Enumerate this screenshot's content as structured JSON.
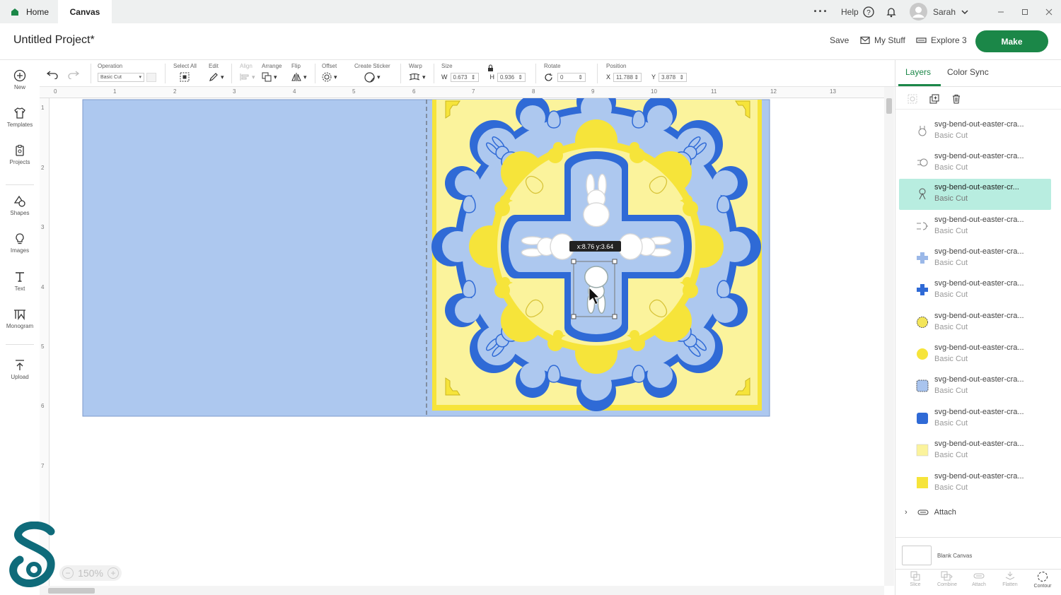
{
  "titlebar": {
    "tabs": [
      {
        "label": "Home"
      },
      {
        "label": "Canvas"
      }
    ],
    "help_label": "Help",
    "user_name": "Sarah"
  },
  "header": {
    "project_title": "Untitled Project*",
    "save_label": "Save",
    "my_stuff_label": "My Stuff",
    "explore_label": "Explore 3",
    "make_label": "Make"
  },
  "toolbar": {
    "operation_label": "Operation",
    "operation_value": "Basic Cut",
    "select_all_label": "Select All",
    "edit_label": "Edit",
    "align_label": "Align",
    "arrange_label": "Arrange",
    "flip_label": "Flip",
    "offset_label": "Offset",
    "create_sticker_label": "Create Sticker",
    "warp_label": "Warp",
    "size_label": "Size",
    "size_w_label": "W",
    "size_w": "0.673",
    "size_h_label": "H",
    "size_h": "0.936",
    "rotate_label": "Rotate",
    "rotate_value": "0",
    "position_label": "Position",
    "pos_x_label": "X",
    "pos_x": "11.788",
    "pos_y_label": "Y",
    "pos_y": "3.878"
  },
  "left_tools": [
    {
      "label": "New"
    },
    {
      "label": "Templates"
    },
    {
      "label": "Projects"
    },
    {
      "label": "Shapes"
    },
    {
      "label": "Images"
    },
    {
      "label": "Text"
    },
    {
      "label": "Monogram"
    },
    {
      "label": "Upload"
    }
  ],
  "rulers": {
    "top": [
      "0",
      "1",
      "2",
      "3",
      "4",
      "5",
      "6",
      "7",
      "8",
      "9",
      "10",
      "11",
      "12",
      "13"
    ],
    "left": [
      "1",
      "2",
      "3",
      "4",
      "5",
      "6",
      "7"
    ]
  },
  "canvas": {
    "tooltip": "x:8.76 y:3.64",
    "zoom": "150%",
    "colors": {
      "light_blue": "#adc8ef",
      "dark_blue": "#2f6ad6",
      "yellow": "#f6e43a",
      "light_yellow": "#fbf39c"
    }
  },
  "right_panel": {
    "tabs": [
      {
        "label": "Layers"
      },
      {
        "label": "Color Sync"
      }
    ],
    "layers": [
      {
        "name": "svg-bend-out-easter-cra...",
        "op": "Basic Cut",
        "swatch": "#ffffff",
        "icon": "bunny-outline-icon"
      },
      {
        "name": "svg-bend-out-easter-cra...",
        "op": "Basic Cut",
        "swatch": "#ffffff",
        "icon": "bunny-outline-icon"
      },
      {
        "name": "svg-bend-out-easter-cr...",
        "op": "Basic Cut",
        "swatch": "#ffffff",
        "icon": "bunny-outline-icon"
      },
      {
        "name": "svg-bend-out-easter-cra...",
        "op": "Basic Cut",
        "swatch": "#ffffff",
        "icon": "bunny-outline-icon"
      },
      {
        "name": "svg-bend-out-easter-cra...",
        "op": "Basic Cut",
        "swatch": "#9bb8e8",
        "icon": "cross-shape-icon"
      },
      {
        "name": "svg-bend-out-easter-cra...",
        "op": "Basic Cut",
        "swatch": "#2f6ad6",
        "icon": "cross-shape-icon"
      },
      {
        "name": "svg-bend-out-easter-cra...",
        "op": "Basic Cut",
        "swatch": "#f3e55a",
        "icon": "flower-shape-icon"
      },
      {
        "name": "svg-bend-out-easter-cra...",
        "op": "Basic Cut",
        "swatch": "#f6e43a",
        "icon": "flower-shape-icon"
      },
      {
        "name": "svg-bend-out-easter-cra...",
        "op": "Basic Cut",
        "swatch": "#a9c4ee",
        "icon": "square-shape-icon"
      },
      {
        "name": "svg-bend-out-easter-cra...",
        "op": "Basic Cut",
        "swatch": "#2f6ad6",
        "icon": "square-shape-icon"
      },
      {
        "name": "svg-bend-out-easter-cra...",
        "op": "Basic Cut",
        "swatch": "#fbf39c",
        "icon": "square-shape-icon"
      },
      {
        "name": "svg-bend-out-easter-cra...",
        "op": "Basic Cut",
        "swatch": "#f6e43a",
        "icon": "square-shape-icon"
      }
    ],
    "attach_label": "Attach",
    "blank_canvas_label": "Blank Canvas",
    "bottom_actions": [
      {
        "label": "Slice"
      },
      {
        "label": "Combine"
      },
      {
        "label": "Attach"
      },
      {
        "label": "Flatten"
      },
      {
        "label": "Contour"
      }
    ]
  }
}
